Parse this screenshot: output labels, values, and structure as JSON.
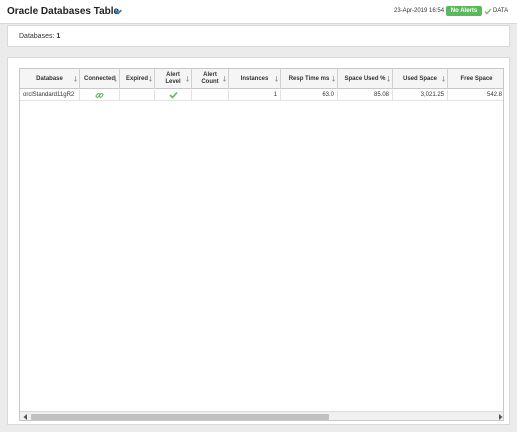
{
  "header": {
    "title": "Oracle Databases Table",
    "timestamp": "23-Apr-2019 16:54",
    "alert_badge": "No Alerts",
    "data_label": "DATA",
    "colors": {
      "badge": "#5cb85c",
      "check": "#5cb85c"
    }
  },
  "summary": {
    "label": "Databases:",
    "count": "1"
  },
  "table": {
    "columns": [
      "Database",
      "Connected",
      "Expired",
      "Alert Level",
      "Alert Count",
      "Instances",
      "Resp Time ms",
      "Space Used %",
      "Used Space",
      "Free Space"
    ],
    "rows": [
      {
        "database": "orclStandard11gR2",
        "connected_icon": "link-icon",
        "expired": "",
        "alert_level_icon": "check-icon",
        "alert_count": "",
        "instances": "1",
        "resp_time_ms": "63.0",
        "space_used_pct": "85.08",
        "used_space": "3,021.25",
        "free_space": "542.8"
      }
    ]
  }
}
